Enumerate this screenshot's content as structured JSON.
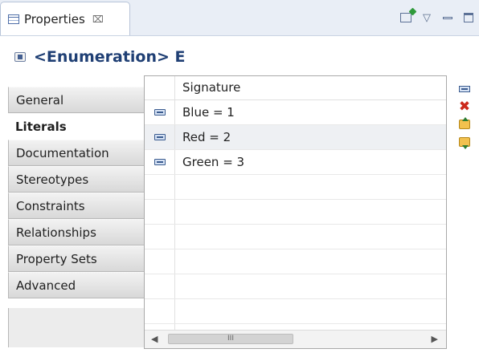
{
  "view": {
    "tab_title": "Properties",
    "tab_close": "⌧"
  },
  "header": {
    "title": "<Enumeration> E"
  },
  "tabs": [
    {
      "label": "General",
      "active": false
    },
    {
      "label": "Literals",
      "active": true
    },
    {
      "label": "Documentation",
      "active": false
    },
    {
      "label": "Stereotypes",
      "active": false
    },
    {
      "label": "Constraints",
      "active": false
    },
    {
      "label": "Relationships",
      "active": false
    },
    {
      "label": "Property Sets",
      "active": false
    },
    {
      "label": "Advanced",
      "active": false
    }
  ],
  "table": {
    "column_header": "Signature",
    "rows": [
      {
        "signature": "Blue = 1",
        "selected": false
      },
      {
        "signature": "Red = 2",
        "selected": true
      },
      {
        "signature": "Green = 3",
        "selected": false
      }
    ],
    "scroll": {
      "left": "◀",
      "right": "▶",
      "thumb": "III"
    }
  },
  "actions": [
    "add-literal-icon",
    "delete-icon",
    "move-up-icon",
    "move-down-icon"
  ]
}
